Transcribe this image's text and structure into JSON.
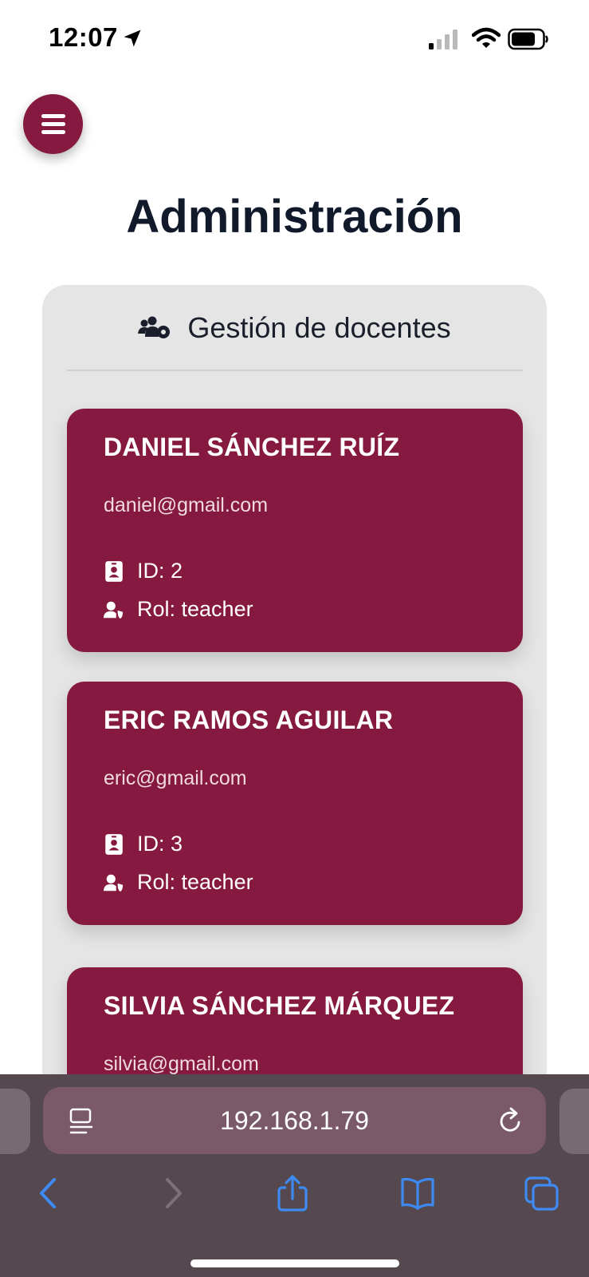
{
  "status_bar": {
    "time": "12:07",
    "icons": [
      "location-arrow-icon",
      "cellular-signal-icon",
      "wifi-icon",
      "battery-icon"
    ]
  },
  "menu": {
    "icon": "hamburger-menu-icon"
  },
  "page": {
    "title": "Administración"
  },
  "panel": {
    "icon": "users-cog-icon",
    "title": "Gestión de docentes",
    "teachers": [
      {
        "name": "DANIEL SÁNCHEZ RUÍZ",
        "email": "daniel@gmail.com",
        "id_text": "ID: 2",
        "role_text": "Rol: teacher"
      },
      {
        "name": "ERIC RAMOS AGUILAR",
        "email": "eric@gmail.com",
        "id_text": "ID: 3",
        "role_text": "Rol: teacher"
      },
      {
        "name": "SILVIA SÁNCHEZ MÁRQUEZ",
        "email": "silvia@gmail.com",
        "id_text": "",
        "role_text": ""
      }
    ]
  },
  "browser": {
    "url": "192.168.1.79",
    "icons": [
      "reader-mode-icon",
      "reload-icon",
      "back-icon",
      "forward-icon",
      "share-icon",
      "bookmarks-icon",
      "tabs-icon"
    ]
  },
  "colors": {
    "accent": "#85193f",
    "panel_bg": "#e5e5e6",
    "title": "#111a2b",
    "browser_bar": "#55484f",
    "ios_blue": "#3d8bf2"
  }
}
